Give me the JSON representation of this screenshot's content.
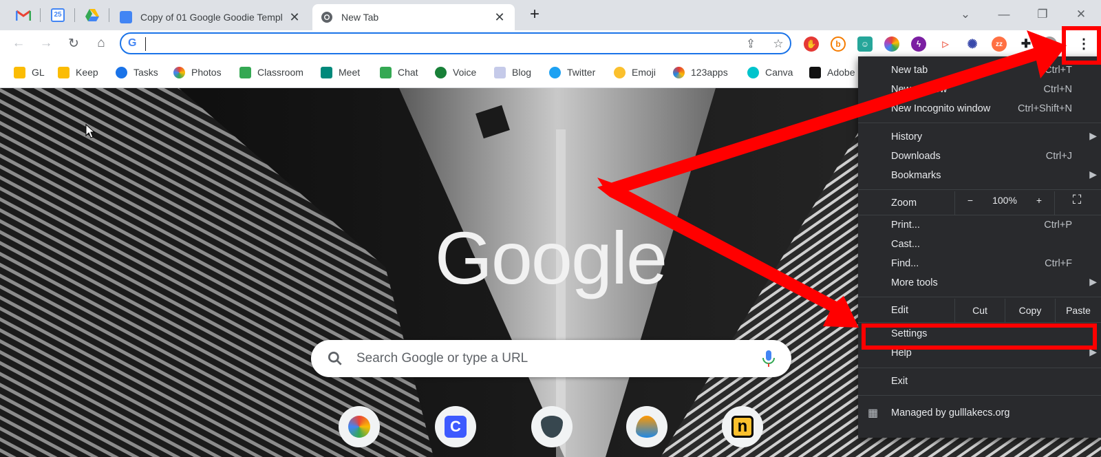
{
  "tabs": {
    "pinned": [
      {
        "name": "gmail",
        "icon": "gmail-icon"
      },
      {
        "name": "calendar",
        "icon": "calendar-icon",
        "label": "25"
      },
      {
        "name": "drive",
        "icon": "drive-icon"
      }
    ],
    "items": [
      {
        "title": "Copy of 01 Google Goodie Templ",
        "icon": "docs-icon",
        "active": false
      },
      {
        "title": "New Tab",
        "icon": "chrome-icon",
        "active": true
      }
    ],
    "new_tab_symbol": "+"
  },
  "toolbar": {
    "omnibox": {
      "value": "",
      "placeholder": ""
    }
  },
  "bookmarks": [
    {
      "label": "GL",
      "color": "#fbbc04"
    },
    {
      "label": "Keep",
      "color": "#fbbc04"
    },
    {
      "label": "Tasks",
      "color": "#1a73e8"
    },
    {
      "label": "Photos",
      "color": "#ea4335"
    },
    {
      "label": "Classroom",
      "color": "#34a853"
    },
    {
      "label": "Meet",
      "color": "#00897b"
    },
    {
      "label": "Chat",
      "color": "#34a853"
    },
    {
      "label": "Voice",
      "color": "#188038"
    },
    {
      "label": "Blog",
      "color": "#5c6bc0"
    },
    {
      "label": "Twitter",
      "color": "#1da1f2"
    },
    {
      "label": "Emoji",
      "color": "#fbc02d"
    },
    {
      "label": "123apps",
      "color": "#e53935"
    },
    {
      "label": "Canva",
      "color": "#00c4cc"
    },
    {
      "label": "Adobe",
      "color": "#111111"
    }
  ],
  "newtab": {
    "logo": "Google",
    "search_placeholder": "Search Google or type a URL"
  },
  "menu": {
    "new_tab": {
      "label": "New tab",
      "shortcut": "Ctrl+T"
    },
    "new_window": {
      "label": "New window",
      "shortcut": "Ctrl+N"
    },
    "new_incognito": {
      "label": "New Incognito window",
      "shortcut": "Ctrl+Shift+N"
    },
    "history": {
      "label": "History"
    },
    "downloads": {
      "label": "Downloads",
      "shortcut": "Ctrl+J"
    },
    "bookmarks": {
      "label": "Bookmarks"
    },
    "zoom": {
      "label": "Zoom",
      "minus": "−",
      "value": "100%",
      "plus": "+"
    },
    "print": {
      "label": "Print...",
      "shortcut": "Ctrl+P"
    },
    "cast": {
      "label": "Cast..."
    },
    "find": {
      "label": "Find...",
      "shortcut": "Ctrl+F"
    },
    "more_tools": {
      "label": "More tools"
    },
    "edit": {
      "label": "Edit",
      "cut": "Cut",
      "copy": "Copy",
      "paste": "Paste"
    },
    "settings": {
      "label": "Settings"
    },
    "help": {
      "label": "Help"
    },
    "exit": {
      "label": "Exit"
    },
    "managed": {
      "label": "Managed by gulllakecs.org"
    }
  },
  "annotation_color": "#ff0000"
}
